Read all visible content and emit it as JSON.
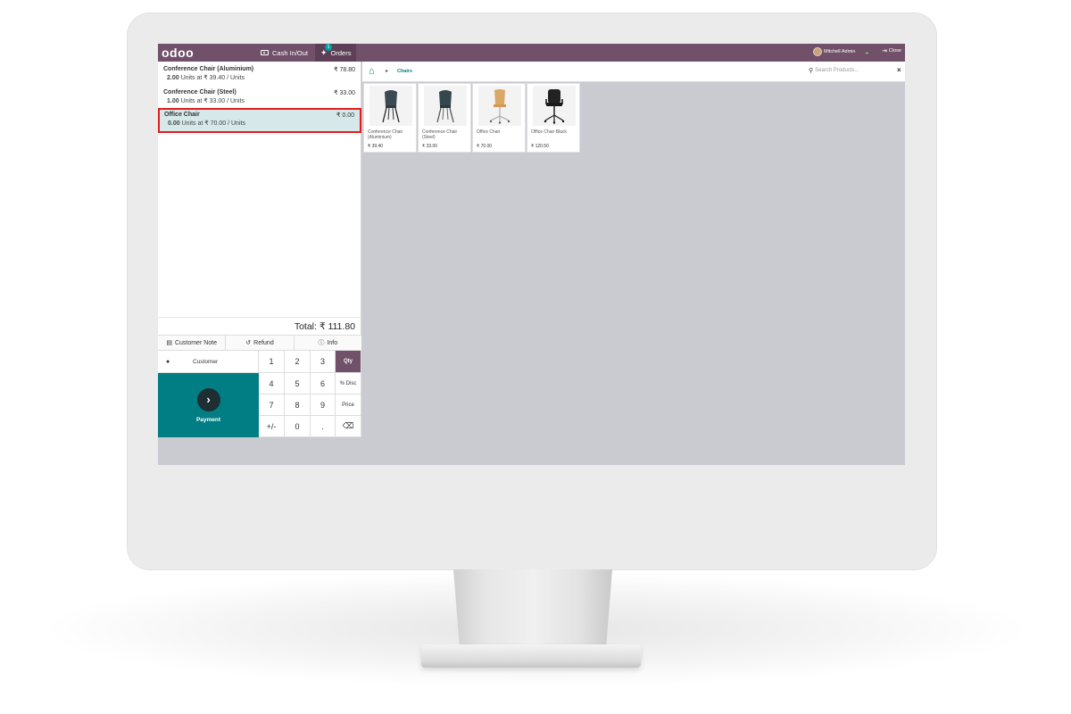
{
  "topbar": {
    "logo": "odoo",
    "cash_label": "Cash In/Out",
    "orders_label": "Orders",
    "orders_badge": "1",
    "user_name": "Mitchell Admin",
    "close_label": "Close"
  },
  "order_lines": [
    {
      "name": "Conference Chair (Aluminium)",
      "price": "₹ 78.80",
      "qty": "2.00",
      "unit_text": "Units at ₹ 39.40 / Units"
    },
    {
      "name": "Conference Chair (Steel)",
      "price": "₹ 33.00",
      "qty": "1.00",
      "unit_text": "Units at ₹ 33.00 / Units"
    },
    {
      "name": "Office Chair",
      "price": "₹ 0.00",
      "qty": "0.00",
      "unit_text": "Units at ₹ 70.00 / Units"
    }
  ],
  "total_label": "Total: ₹ 111.80",
  "actions": {
    "customer_note": "Customer Note",
    "refund": "Refund",
    "info": "Info"
  },
  "customer_label": "Customer",
  "payment_label": "Payment",
  "keypad": {
    "k1": "1",
    "k2": "2",
    "k3": "3",
    "qty": "Qty",
    "k4": "4",
    "k5": "5",
    "k6": "6",
    "disc": "% Disc",
    "k7": "7",
    "k8": "8",
    "k9": "9",
    "price": "Price",
    "plusminus": "+/-",
    "k0": "0",
    "dot": ".",
    "backspace": "⌫"
  },
  "breadcrumb": {
    "category": "Chairs"
  },
  "search": {
    "placeholder": "Search Products..."
  },
  "products": [
    {
      "name": "Conference Chair (Aluminium)",
      "price": "₹ 39.40"
    },
    {
      "name": "Conference Chair (Steel)",
      "price": "₹ 33.00"
    },
    {
      "name": "Office Chair",
      "price": "₹ 70.00"
    },
    {
      "name": "Office Chair Black",
      "price": "₹ 120.50"
    }
  ],
  "colors": {
    "topbar": "#71506a",
    "accent": "#017e84",
    "selected_line": "#d6e8ea",
    "highlight": "#e21c1c"
  }
}
